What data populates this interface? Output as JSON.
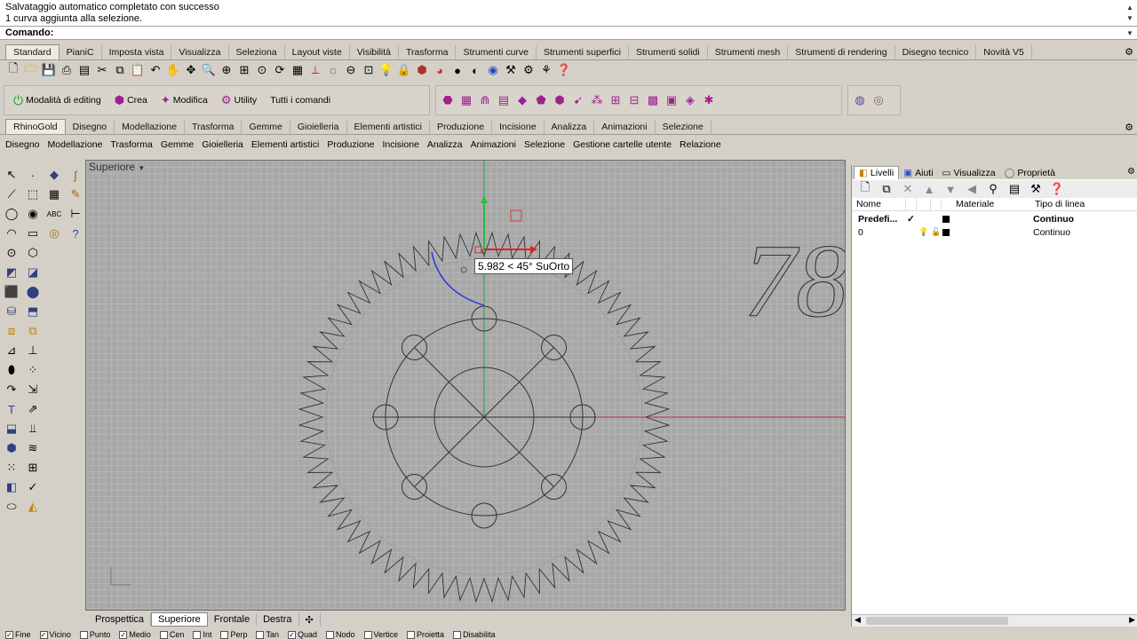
{
  "history": {
    "line1": "Salvataggio automatico completato con successo",
    "line2": "1 curva aggiunta alla selezione."
  },
  "command": {
    "label": "Comando:"
  },
  "tabs_top": [
    "Standard",
    "PianiC",
    "Imposta vista",
    "Visualizza",
    "Seleziona",
    "Layout viste",
    "Visibilità",
    "Trasforma",
    "Strumenti curve",
    "Strumenti superfici",
    "Strumenti solidi",
    "Strumenti mesh",
    "Strumenti di rendering",
    "Disegno tecnico",
    "Novità V5"
  ],
  "toolbar2": {
    "edit_mode": "Modalità di editing",
    "create": "Crea",
    "modify": "Modifica",
    "utility": "Utility",
    "all_commands": "Tutti i comandi"
  },
  "tabs_rhinogold": [
    "RhinoGold",
    "Disegno",
    "Modellazione",
    "Trasforma",
    "Gemme",
    "Gioielleria",
    "Elementi artistici",
    "Produzione",
    "Incisione",
    "Analizza",
    "Animazioni",
    "Selezione"
  ],
  "menu_rhinogold": [
    "Disegno",
    "Modellazione",
    "Trasforma",
    "Gemme",
    "Gioielleria",
    "Elementi artistici",
    "Produzione",
    "Incisione",
    "Analizza",
    "Animazioni",
    "Selezione",
    "Gestione cartelle utente",
    "Relazione"
  ],
  "viewport": {
    "title": "Superiore",
    "tooltip": "5.982 < 45° SuOrto",
    "number_text": "78",
    "gear_teeth": 72
  },
  "viewport_tabs": [
    "Prospettica",
    "Superiore",
    "Frontale",
    "Destra"
  ],
  "osnaps": [
    {
      "label": "Fine",
      "checked": true
    },
    {
      "label": "Vicino",
      "checked": true
    },
    {
      "label": "Punto",
      "checked": false
    },
    {
      "label": "Medio",
      "checked": true
    },
    {
      "label": "Cen",
      "checked": false
    },
    {
      "label": "Int",
      "checked": false
    },
    {
      "label": "Perp",
      "checked": false
    },
    {
      "label": "Tan",
      "checked": false
    },
    {
      "label": "Quad",
      "checked": true
    },
    {
      "label": "Nodo",
      "checked": false
    },
    {
      "label": "Vertice",
      "checked": false
    },
    {
      "label": "Proietta",
      "checked": false
    },
    {
      "label": "Disabilita",
      "checked": false
    }
  ],
  "panel": {
    "tabs": [
      "Livelli",
      "Aiuti",
      "Visualizza",
      "Proprietà"
    ],
    "columns": {
      "name": "Nome",
      "material": "Materiale",
      "linetype": "Tipo di linea"
    },
    "layers": [
      {
        "name": "Predefi...",
        "current": "✓",
        "linetype": "Continuo"
      },
      {
        "name": "0",
        "current": "",
        "linetype": "Continuo"
      }
    ]
  },
  "colors": {
    "x_axis": "#c03040",
    "y_axis": "#20a040",
    "selection": "#2030e0"
  }
}
